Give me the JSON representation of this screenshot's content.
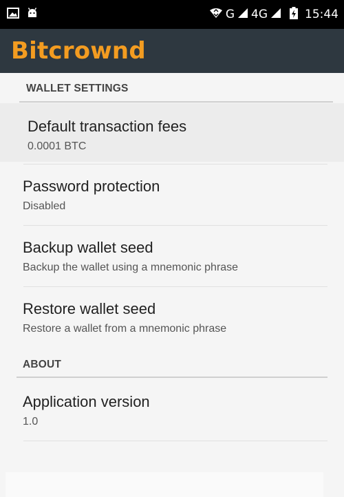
{
  "status_bar": {
    "left_icons": [
      "image-icon",
      "android-icon"
    ],
    "network_1": "G",
    "network_2": "4G",
    "time": "15:44"
  },
  "app_bar": {
    "brand_title": "Bitcrownd",
    "brand_color": "#f39c21",
    "background": "#2e3840"
  },
  "sections": [
    {
      "header": "WALLET SETTINGS",
      "items": [
        {
          "title": "Default transaction fees",
          "summary": "0.0001 BTC"
        },
        {
          "title": "Password protection",
          "summary": "Disabled"
        },
        {
          "title": "Backup wallet seed",
          "summary": "Backup the wallet using a mnemonic phrase"
        },
        {
          "title": "Restore wallet seed",
          "summary": "Restore a wallet from a mnemonic phrase"
        }
      ]
    },
    {
      "header": "ABOUT",
      "items": [
        {
          "title": "Application version",
          "summary": "1.0"
        }
      ]
    }
  ]
}
